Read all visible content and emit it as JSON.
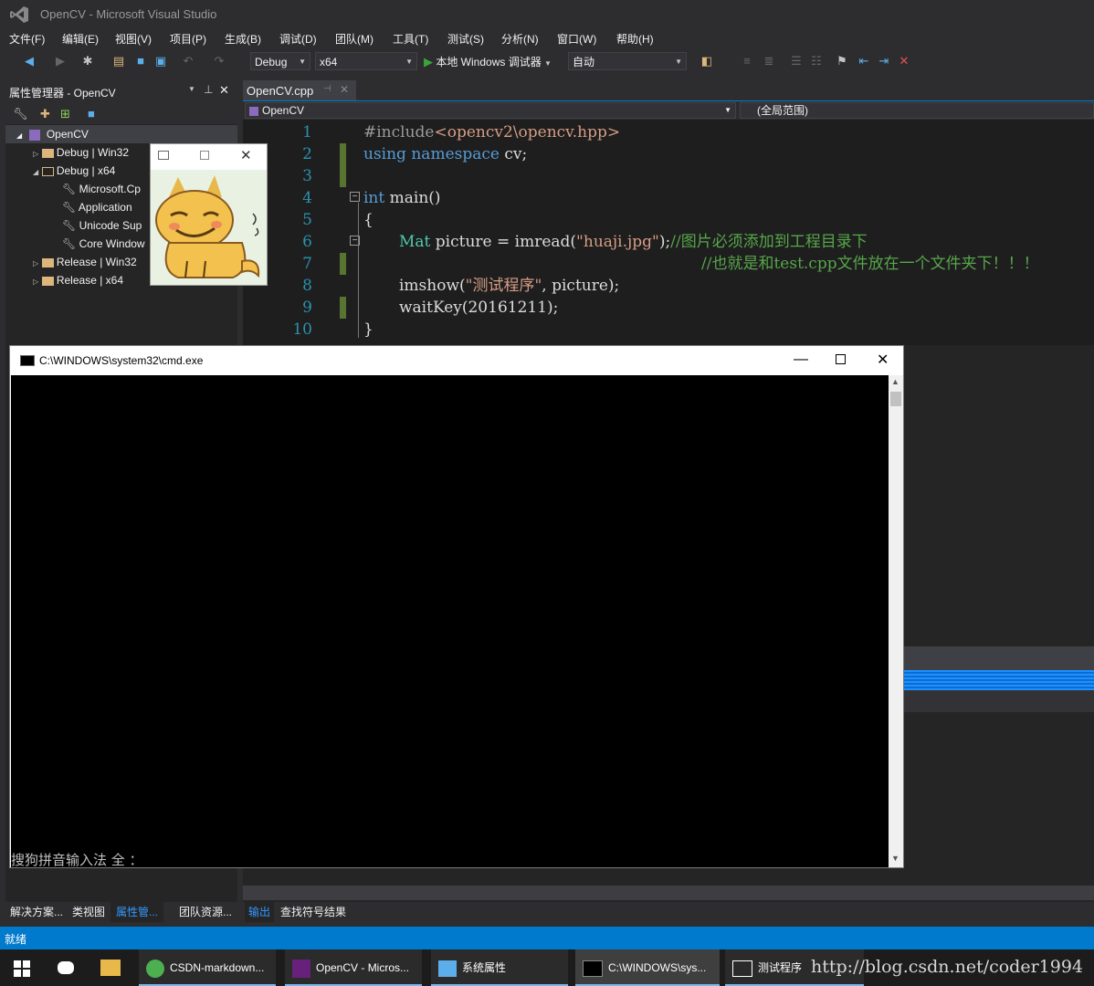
{
  "window": {
    "title": "OpenCV - Microsoft Visual Studio"
  },
  "menu": [
    "文件(F)",
    "编辑(E)",
    "视图(V)",
    "项目(P)",
    "生成(B)",
    "调试(D)",
    "团队(M)",
    "工具(T)",
    "测试(S)",
    "分析(N)",
    "窗口(W)",
    "帮助(H)"
  ],
  "toolbar": {
    "config": "Debug",
    "platform": "x64",
    "run_label": "本地 Windows 调试器",
    "auto": "自动"
  },
  "property_manager": {
    "title": "属性管理器 - OpenCV",
    "root": "OpenCV",
    "items": [
      "Debug | Win32",
      "Debug | x64",
      "Microsoft.Cp",
      "Application",
      "Unicode Sup",
      "Core Window",
      "Release | Win32",
      "Release | x64"
    ]
  },
  "editor": {
    "tab_label": "OpenCV.cpp",
    "nav_left": "OpenCV",
    "nav_right": "(全局范围)",
    "line_numbers": [
      "1",
      "2",
      "3",
      "4",
      "5",
      "6",
      "7",
      "8",
      "9",
      "10"
    ],
    "code": {
      "l1a": "#include",
      "l1b": "<opencv2\\opencv.hpp>",
      "l2a": "using",
      "l2b": "namespace",
      "l2c": " cv;",
      "l4a": "int",
      "l4b": " main()",
      "l5": "{",
      "l6a": "Mat",
      "l6b": " picture = imread(",
      "l6c": "\"huaji.jpg\"",
      "l6d": ");",
      "l6e": "//图片必须添加到工程目录下",
      "l7": "//也就是和test.cpp文件放在一个文件夹下！！！",
      "l8a": "imshow(",
      "l8b": "\"测试程序\"",
      "l8c": ", picture);",
      "l9": "waitKey(20161211);",
      "l10": "}"
    }
  },
  "cmd": {
    "title": "C:\\WINDOWS\\system32\\cmd.exe",
    "ime": "搜狗拼音输入法 全 ："
  },
  "bottom_tabs": [
    "解决方案...",
    "类视图",
    "属性管...",
    "团队资源...",
    "输出",
    "查找符号结果"
  ],
  "status": "就绪",
  "taskbar": [
    "CSDN-markdown...",
    "OpenCV - Micros...",
    "系统属性",
    "C:\\WINDOWS\\sys...",
    "测试程序"
  ],
  "watermark": "http://blog.csdn.net/coder1994",
  "colors": {
    "status": "#007acc",
    "accent": "#68217a"
  }
}
